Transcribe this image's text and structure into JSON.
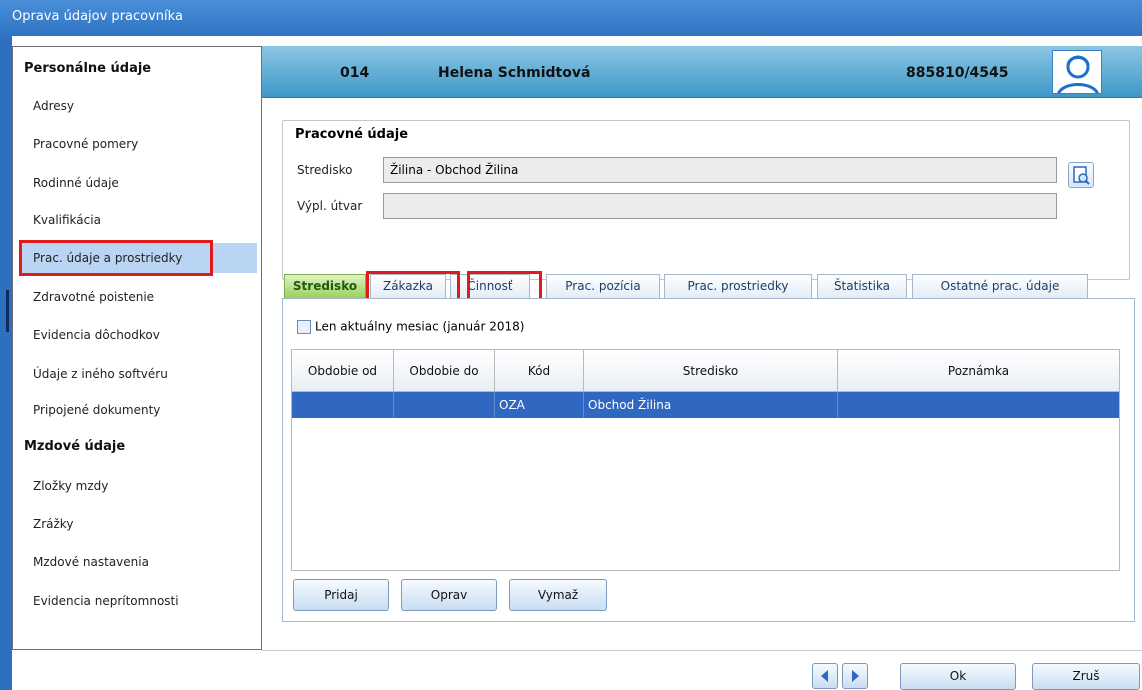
{
  "window": {
    "title": "Oprava údajov pracovníka"
  },
  "sidebar": {
    "sections": [
      {
        "title": "Personálne údaje"
      },
      {
        "title": "Mzdové údaje"
      }
    ],
    "items": [
      {
        "label": "Adresy"
      },
      {
        "label": "Pracovné pomery"
      },
      {
        "label": "Rodinné údaje"
      },
      {
        "label": "Kvalifikácia"
      },
      {
        "label": "Prac. údaje a prostriedky",
        "selected": true
      },
      {
        "label": "Zdravotné poistenie"
      },
      {
        "label": "Evidencia dôchodkov"
      },
      {
        "label": "Údaje z iného softvéru"
      },
      {
        "label": "Pripojené dokumenty"
      },
      {
        "label": "Zložky mzdy"
      },
      {
        "label": "Zrážky"
      },
      {
        "label": "Mzdové nastavenia"
      },
      {
        "label": "Evidencia neprítomnosti"
      }
    ]
  },
  "header": {
    "code": "014",
    "name": "Helena Schmidtová",
    "id_number": "885810/4545",
    "avatar_icon": "person-avatar-icon"
  },
  "work_data": {
    "title": "Pracovné údaje",
    "stredisko_label": "Stredisko",
    "stredisko_value": "Žilina - Obchod Žilina",
    "vypl_utvar_label": "Výpl. útvar",
    "vypl_utvar_value": ""
  },
  "tabs": [
    {
      "label": "Stredisko",
      "active": true
    },
    {
      "label": "Zákazka"
    },
    {
      "label": "Činnosť"
    },
    {
      "label": "Prac. pozícia"
    },
    {
      "label": "Prac. prostriedky"
    },
    {
      "label": "Štatistika"
    },
    {
      "label": "Ostatné prac. údaje"
    }
  ],
  "filter": {
    "checkbox_label": "Len aktuálny mesiac (január 2018)",
    "checked": false
  },
  "table": {
    "columns": [
      "Obdobie od",
      "Obdobie do",
      "Kód",
      "Stredisko",
      "Poznámka"
    ],
    "rows": [
      {
        "obdobie_od": "",
        "obdobie_do": "",
        "kod": "OZA",
        "stredisko": "Obchod Žilina",
        "poznamka": "",
        "selected": true
      }
    ]
  },
  "actions": {
    "add": "Pridaj",
    "edit": "Oprav",
    "delete": "Vymaž"
  },
  "footer": {
    "ok": "Ok",
    "cancel": "Zruš"
  },
  "colors": {
    "accent": "#2f67c1",
    "highlight": "#e11b1b",
    "active_tab": "#9bd05c"
  }
}
